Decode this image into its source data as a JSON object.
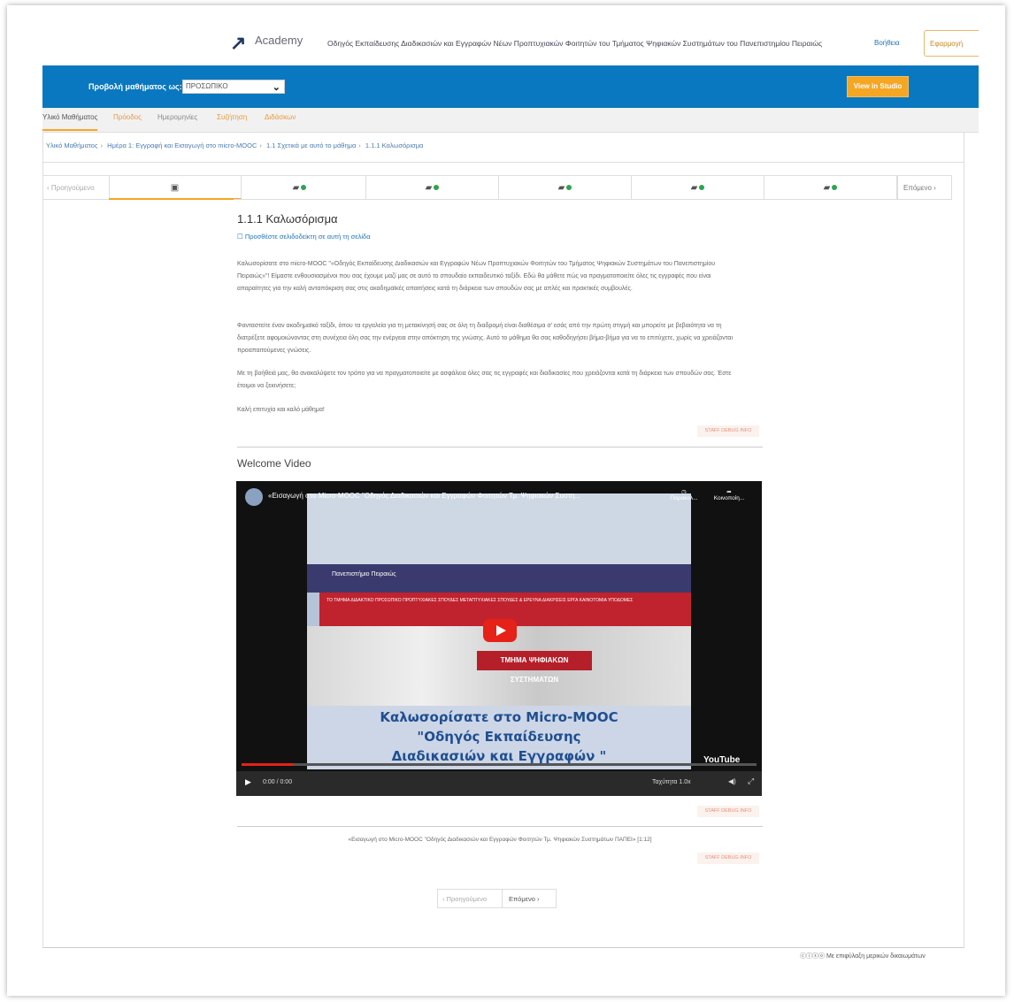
{
  "header": {
    "logo_mark": "↗",
    "logo_text": "Academy",
    "course_title": "Οδηγός Εκπαίδευσης Διαδικασιών και Εγγραφών Νέων Προπτυχιακών Φοιτητών του Τμήματος Ψηφιακών Συστημάτων του Πανεπιστημίου Πειραιώς",
    "help_label": "Βοήθεια",
    "signin_label": "Εφαρμογή"
  },
  "preview": {
    "label": "Προβολή μαθήματος ως:",
    "select_value": "ΠΡΟΣΩΠΙΚΟ",
    "studio_button": "View in Studio"
  },
  "tabs": [
    {
      "label": "Υλικό Μαθήματος"
    },
    {
      "label": "Πρόοδος"
    },
    {
      "label": "Ημερομηνίες"
    },
    {
      "label": "Συζήτηση"
    },
    {
      "label": "Διδάσκων"
    }
  ],
  "breadcrumb": [
    "Υλικό Μαθήματος",
    "Ημέρα 1: Εγγραφή και Εισαγωγή στο micro-MOOC",
    "1.1 Σχετικά με αυτό το μάθημα",
    "1.1.1 Καλωσόρισμα"
  ],
  "sequence": {
    "prev_label": "Προηγούμενο",
    "next_label": "Επόμενο"
  },
  "unit": {
    "title": "1.1.1 Καλωσόρισμα",
    "bookmark": "Προσθέστε σελιδοδείκτη σε αυτή τη σελίδα",
    "paragraphs": [
      "Καλωσορίσατε στο micro-MOOC \"«Οδηγός Εκπαίδευσης Διαδικασιών και Εγγραφών Νέων Προπτυχιακών Φοιτητών του Τμήματος Ψηφιακών Συστημάτων του Πανεπιστημίου Πειραιώς»\"! Είμαστε ενθουσιασμένοι που σας έχουμε μαζί μας σε αυτό το σπουδαίο εκπαιδευτικό ταξίδι. Εδώ θα μάθετε πώς να πραγματοποιείτε όλες τις εγγραφές που είναι απαραίτητες για την καλή ανταπόκριση σας στις ακαδημαϊκές απαιτήσεις κατά τη διάρκεια των σπουδών σας με απλές και πρακτικές συμβουλές.",
      "Φανταστείτε έναν ακαδημαϊκό ταξίδι, όπου τα εργαλεία για τη μετακίνησή σας σε όλη τη διαδρομή είναι διαθέσιμα σ' εσάς από την πρώτη στιγμή και μπορείτε με βεβαιότητα να τη διατρέξετε αφομοιώνοντας στη συνέχεια όλη σας την ενέργεια στην απόκτηση της γνώσης. Αυτό το μάθημα θα σας καθοδηγήσει βήμα-βήμα για να το επιτύχετε, χωρίς να χρειάζονται προαπαιτούμενες γνώσεις.",
      "Με τη βοήθειά μας, θα ανακαλύψετε τον τρόπο για να πραγματοποιείτε με ασφάλεια όλες σας τις εγγραφές και διαδικασίες που χρειάζονται κατά τη διάρκεια των σπουδών σας. Έστε έτοιμοι να ξεκινήσετε;",
      "Καλή επιτυχία και καλό μάθημα!"
    ],
    "staff_debug": "STAFF DEBUG INFO",
    "video_heading": "Welcome Video",
    "transcript": "«Εισαγωγή στο Micro-MOOC \"Οδηγός Διαδικασιών και Εγγραφών Φοιτητών Τμ. Ψηφιακών Συστημάτων ΠΑΠΕΙ» [1:12]"
  },
  "video": {
    "title": "«Εισαγωγή στο Micro-MOOC \"Οδηγός Διαδικασιών και Εγγραφών Φοιτητών Τμ. Ψηφιακών Συστη...",
    "watch_later": "Παρακολ...",
    "share": "Κοινοποίη...",
    "university": "Πανεπιστήμιο Πειραιώς",
    "menu_text": "ΤΟ ΤΜΗΜΑ   ΔΙΔΑΚΤΙΚΟ ΠΡΟΣΩΠΙΚΟ   ΠΡΟΠΤΥΧΙΑΚΕΣ ΣΠΟΥΔΕΣ   ΜΕΤΑΠΤΥΧΙΑΚΕΣ ΣΠΟΥΔΕΣ & ΕΡΕΥΝΑ   ΔΙΑΚΡΙΣΕΙΣ ΕΡΓΑ   ΚΑΙΝΟΤΟΜΙΑ   ΥΠΟΔΟΜΕΣ",
    "sign": "ΤΜΗΜΑ ΨΗΦΙΑΚΩΝ ΣΥΣΤΗΜΑΤΩΝ",
    "welcome_line1": "Καλωσορίσατε στο Micro-MOOC",
    "welcome_line2": "\"Οδηγός Εκπαίδευσης",
    "welcome_line3": "Διαδικασιών και Εγγραφών \"",
    "time": "0:00 / 0:00",
    "speed": "Ταχύτητα 1.0x",
    "youtube": "YouTube",
    "progress": 0.1,
    "brand_red": "#e62117"
  },
  "bottom_nav": {
    "prev_label": "Προηγούμενο",
    "next_label": "Επόμενο"
  },
  "footer": {
    "license": "Με επιφύλαξη μερικών δικαιωμάτων"
  },
  "colors": {
    "accent_blue": "#0a78c0",
    "accent_orange": "#f5a623"
  }
}
